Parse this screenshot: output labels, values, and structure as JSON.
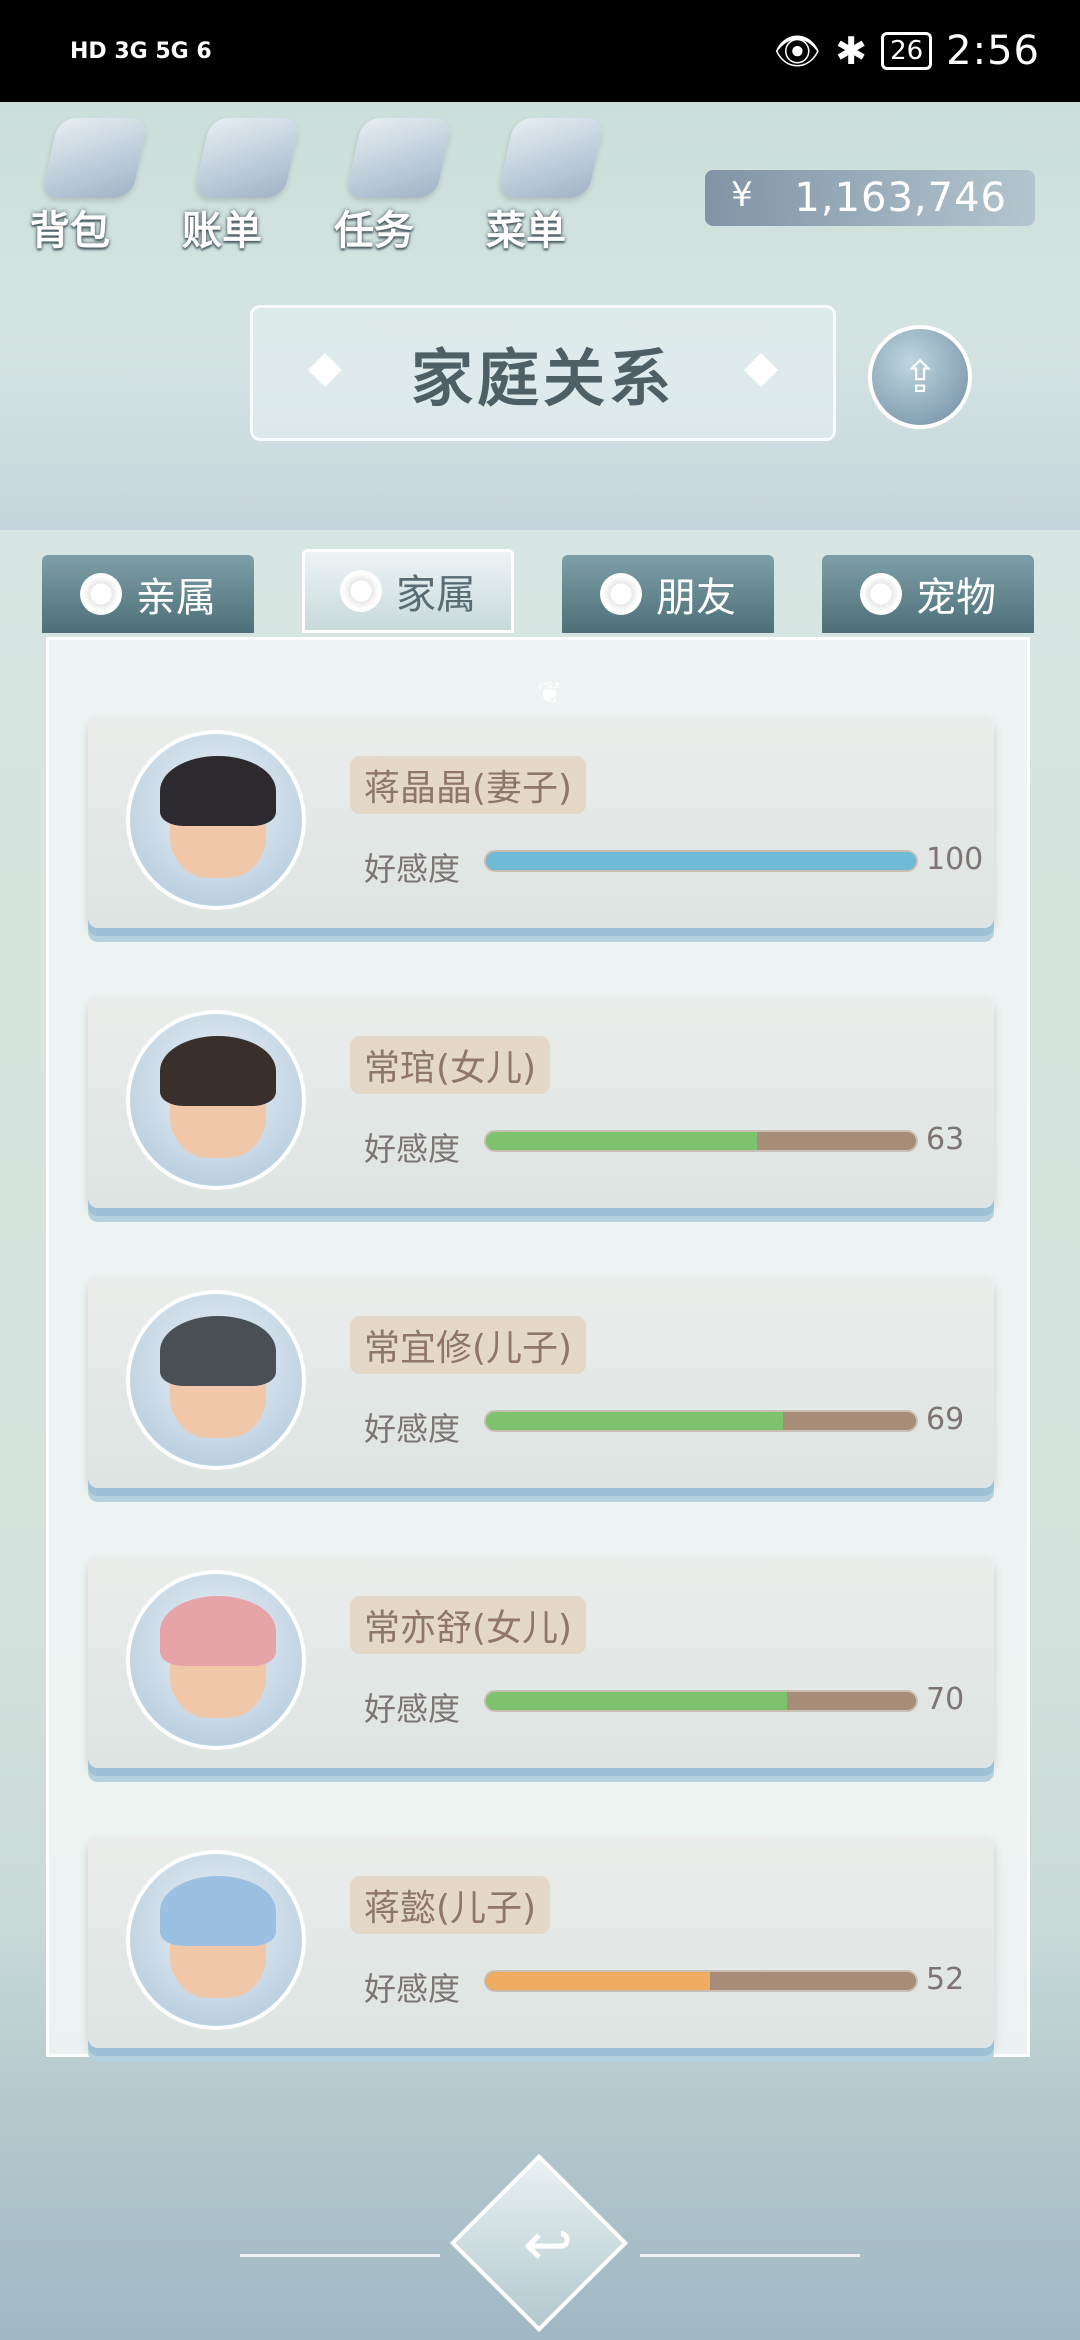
{
  "status_bar": {
    "left_icons": [
      "HD2",
      "3G",
      "5G",
      "wifi-6",
      "location"
    ],
    "left_text": "HD 3G 5G 6",
    "time": "2:56",
    "battery": "26"
  },
  "top_menu": [
    {
      "label": "背包",
      "icon": "bag-icon"
    },
    {
      "label": "账单",
      "icon": "bill-icon"
    },
    {
      "label": "任务",
      "icon": "task-icon"
    },
    {
      "label": "菜单",
      "icon": "menu-icon"
    }
  ],
  "money": {
    "symbol": "¥",
    "amount": "1,163,746"
  },
  "title": "家庭关系",
  "tabs": [
    {
      "label": "亲属",
      "active": false
    },
    {
      "label": "家属",
      "active": true
    },
    {
      "label": "朋友",
      "active": false
    },
    {
      "label": "宠物",
      "active": false
    }
  ],
  "family": [
    {
      "name": "蒋晶晶(妻子)",
      "favor_label": "好感度",
      "favor": 100,
      "bar_color": "#6fbad6"
    },
    {
      "name": "常琯(女儿)",
      "favor_label": "好感度",
      "favor": 63,
      "bar_color": "#7dc36d"
    },
    {
      "name": "常宜修(儿子)",
      "favor_label": "好感度",
      "favor": 69,
      "bar_color": "#7dc36d"
    },
    {
      "name": "常亦舒(女儿)",
      "favor_label": "好感度",
      "favor": 70,
      "bar_color": "#7dc36d"
    },
    {
      "name": "蒋懿(儿子)",
      "favor_label": "好感度",
      "favor": 52,
      "bar_color": "#f0ac60"
    }
  ],
  "icons": {
    "share": "share-icon",
    "back": "back-arrow-icon",
    "flower": "flower-icon"
  }
}
